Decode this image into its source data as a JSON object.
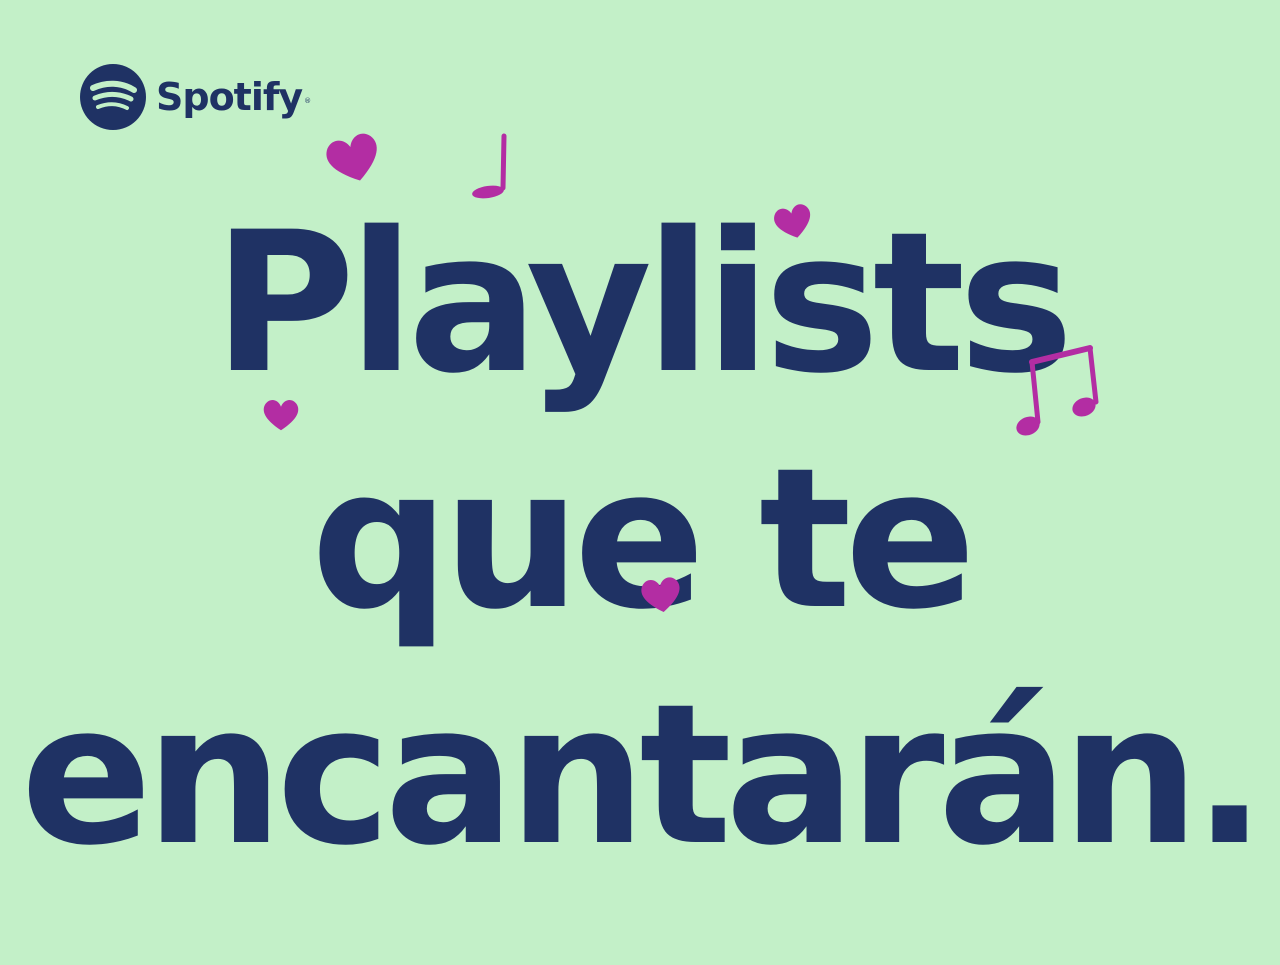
{
  "brand": {
    "name": "Spotify",
    "registered_mark": "®",
    "logo_icon": "spotify-logo-icon",
    "color": "#1f3264"
  },
  "headline": {
    "line1": "Playlists",
    "line2": "que te",
    "line3": "encantarán."
  },
  "colors": {
    "background": "#c3f0c8",
    "text": "#1f3264",
    "accent": "#b32da3"
  },
  "decorations": [
    "heart-icon",
    "music-note-icon",
    "beamed-music-notes-icon"
  ]
}
